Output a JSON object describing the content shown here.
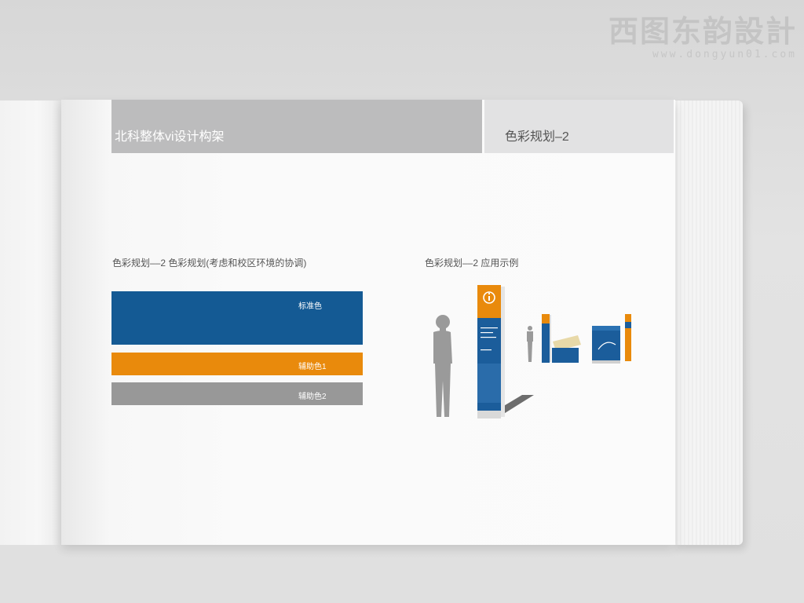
{
  "watermark": {
    "title": "西图东韵設計",
    "url": "www.dongyun01.com"
  },
  "header": {
    "left_title": "北科整体vi设计构架",
    "right_title": "色彩规划–2"
  },
  "left_section": {
    "caption": "色彩规划––2 色彩规划(考虑和校区环境的协调)",
    "swatches": [
      {
        "label": "标准色",
        "color": "#145a94"
      },
      {
        "label": "辅助色1",
        "color": "#e98a0c"
      },
      {
        "label": "辅助色2",
        "color": "#989898"
      }
    ]
  },
  "right_section": {
    "caption": "色彩规划––2 应用示例"
  },
  "icons": {
    "info": "info-icon"
  }
}
